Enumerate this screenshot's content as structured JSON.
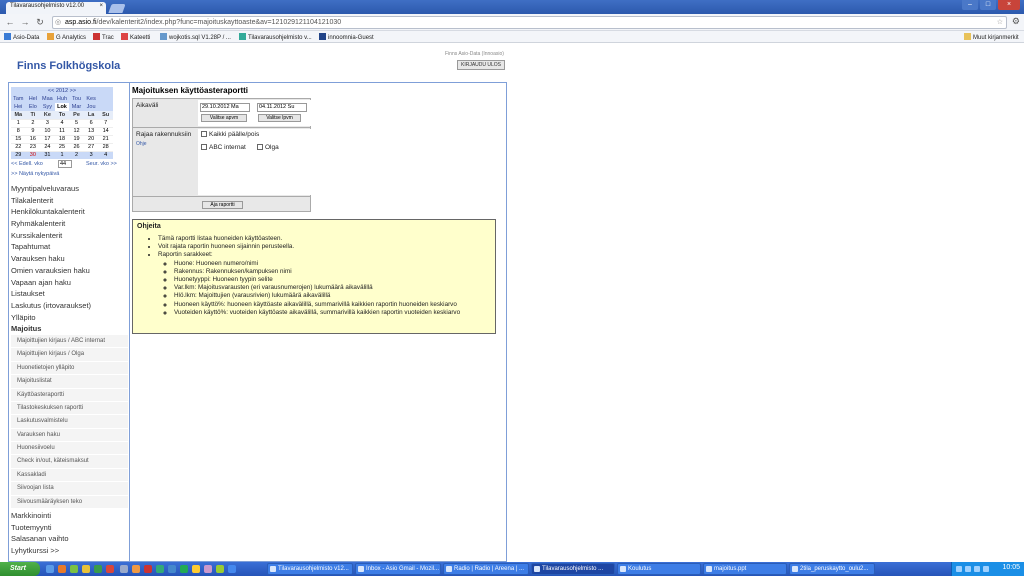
{
  "browser": {
    "tab_title": "Tilavarausohjelmisto v12.00",
    "url_host": "asp.asio.fi",
    "url_path": "/dev/kalenterit2/index.php?func=majoituskayttoaste&av=121029121104121030",
    "bookmarks": [
      "Asio-Data",
      "G Analytics",
      "Trac",
      "Kateetti",
      "wojkotis.sql V1.28P / ...",
      "Tilavarausohjelmisto v...",
      "innoomnia-Guest"
    ],
    "other_bookmarks": "Muut kirjanmerkit"
  },
  "site": {
    "title": "Finns Folkhögskola",
    "company": "Finns Asio-Data (Innoasio)",
    "logout": "KIRJAUDU ULOS"
  },
  "calendar": {
    "year_nav": "<< 2012 >>",
    "months_row1": [
      "Tam",
      "Hel",
      "Maa",
      "Huh",
      "Tou",
      "Kes"
    ],
    "months_row2": [
      "Hei",
      "Elo",
      "Syy",
      "Lok",
      "Mar",
      "Jou"
    ],
    "current_month": "Lok",
    "weekdays": [
      "Ma",
      "Ti",
      "Ke",
      "To",
      "Pe",
      "La",
      "Su"
    ],
    "weeks": [
      [
        "1",
        "2",
        "3",
        "4",
        "5",
        "6",
        "7"
      ],
      [
        "8",
        "9",
        "10",
        "11",
        "12",
        "13",
        "14"
      ],
      [
        "15",
        "16",
        "17",
        "18",
        "19",
        "20",
        "21"
      ],
      [
        "22",
        "23",
        "24",
        "25",
        "26",
        "27",
        "28"
      ],
      [
        "29",
        "30",
        "31",
        "1",
        "2",
        "3",
        "4"
      ]
    ],
    "prev_week": "<< Edell. vko",
    "week_number": "44",
    "next_week": "Seur. vko >>",
    "show_today": ">> Näytä nykypäivä"
  },
  "menu": {
    "items": [
      "Myyntipalveluvaraus",
      "Tilakalenterit",
      "Henkilökuntakalenterit",
      "Ryhmäkalenterit",
      "Kurssikalenterit",
      "Tapahtumat",
      "Varauksen haku",
      "Omien varauksien haku",
      "Vapaan ajan haku",
      "Listaukset",
      "Laskutus (irtovaraukset)",
      "Ylläpito"
    ],
    "active": "Majoitus",
    "subitems": [
      "Majoittujien kirjaus / ABC internat",
      "Majoittujien kirjaus / Olga",
      "Huonetietojen ylläpito",
      "Majoituslistat",
      "Käyttöasteraportti",
      "Tilastokeskuksen raportti",
      "Laskutusvalmistelu",
      "Varauksen haku",
      "Huonesiivoelu",
      "Check in/out, käteismaksut",
      "Kassakladi",
      "Siivoojan lista",
      "Siivousmääräyksen teko"
    ],
    "items_after": [
      "Markkinointi",
      "Tuotemyynti",
      "Salasanan vaihto",
      "Lyhytkurssi >>"
    ]
  },
  "report": {
    "title": "Majoituksen käyttöasteraportti",
    "period_label": "Aikaväli",
    "date_from": "29.10.2012 Ma",
    "date_to": "04.11.2012 Su",
    "pick_start": "Valitse apvm",
    "pick_end": "Valitse lpvm",
    "limit_label": "Rajaa rakennuksiin",
    "help_link": "Ohje",
    "all_toggle": "Kaikki päälle/pois",
    "buildings": [
      "ABC internat",
      "Olga"
    ],
    "run_button": "Aja raportti"
  },
  "help": {
    "title": "Ohjeita",
    "bullets": [
      "Tämä raportti listaa huoneiden käyttöasteen.",
      "Voit rajata raportin huoneen sijainnin perusteella.",
      "Raportin sarakkeet:"
    ],
    "columns": [
      "Huone: Huoneen numero/nimi",
      "Rakennus: Rakennuksen/kampuksen nimi",
      "Huonetyyppi: Huoneen tyypin selite",
      "Var.lkm: Majoitusvarausten (eri varausnumerojen) lukumäärä aikavälillä",
      "Hlö.lkm: Majoittujien (varausrivien) lukumäärä aikavälillä",
      "Huoneen käyttö%: huoneen käyttöaste aikavälillä, summarivillä kaikkien raportin huoneiden keskiarvo",
      "Vuoteiden käyttö%: vuoteiden käyttöaste aikavälillä, summarivillä kaikkien raportin vuoteiden keskiarvo"
    ]
  },
  "taskbar": {
    "start": "Start",
    "windows": [
      "Tilavarausohjelmisto v12...",
      "Inbox - Asio Gmail - Mozil...",
      "Radio | Radio | Areena | ...",
      "Tilavarausohjelmisto ...",
      "Koulutus",
      "majoitus.ppt",
      "2tila_peruskaytto_oulu2..."
    ],
    "active_window": 3,
    "clock": "10:05"
  }
}
